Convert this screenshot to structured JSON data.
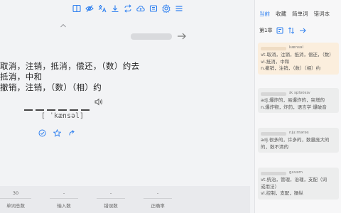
{
  "toolbar": {
    "icons": [
      "window-icon",
      "eye-off-icon",
      "translate-icon",
      "download-icon",
      "loop-icon",
      "cloud-upload-icon",
      "folder-icon",
      "gear-icon",
      "menu-icon"
    ]
  },
  "word": {
    "translations": [
      "取消，注销，抵消，偿还，（数）约去",
      "抵消，中和",
      "撤销，注销，（数）（相）约"
    ],
    "phonetic": "[ ˈkænsəl]"
  },
  "stats": [
    {
      "value": "30",
      "label": "单词总数"
    },
    {
      "value": "-",
      "label": "输入数"
    },
    {
      "value": "-",
      "label": "错误数"
    },
    {
      "value": "-",
      "label": "正确率"
    }
  ],
  "sidebar": {
    "tabs": [
      "当前",
      "收藏",
      "简单词",
      "错词本"
    ],
    "chapter": "第1章",
    "cards": [
      {
        "pron": "kænsəl",
        "defs": [
          "vt.取消，注销，抵消，偿还，（数）",
          "vi.抵消，中和",
          "n.撤销，注销，（数）（相）约"
        ]
      },
      {
        "pron": "ɪk sploʊsɪv",
        "defs": [
          "adj.爆炸的，易爆炸的，突增的",
          "n.爆炸物，炸药，语言学 爆破音"
        ]
      },
      {
        "pron": "nju:mərəs",
        "defs": [
          "adj.很多的，许多的，数量庞大的",
          "的，数不清的"
        ]
      },
      {
        "pron": "gʌvərn",
        "defs": [
          "vt.统治，管理，治理，支配（词",
          "或用法）",
          "vi.控制，支配，操纵"
        ]
      }
    ]
  },
  "colors": {
    "accent": "#2d7ff0",
    "selected_card": "#fbeedd"
  }
}
